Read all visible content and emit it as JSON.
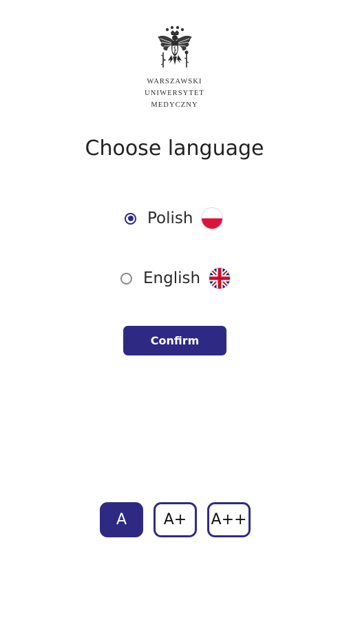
{
  "logo": {
    "name": "eagle-crest-logo",
    "lines": [
      "WARSZAWSKI",
      "UNIWERSYTET",
      "MEDYCZNY"
    ]
  },
  "title": "Choose language",
  "languages": [
    {
      "label": "Polish",
      "selected": true,
      "flag": "poland-flag-icon"
    },
    {
      "label": "English",
      "selected": false,
      "flag": "uk-flag-icon"
    }
  ],
  "confirm_label": "Confirm",
  "font_sizes": [
    {
      "label": "A",
      "active": true
    },
    {
      "label": "A+",
      "active": false
    },
    {
      "label": "A++",
      "active": false
    }
  ],
  "colors": {
    "accent": "#2e2a84",
    "flag_red": "#dc143c",
    "uk_blue": "#012169",
    "uk_red": "#C8102E"
  }
}
